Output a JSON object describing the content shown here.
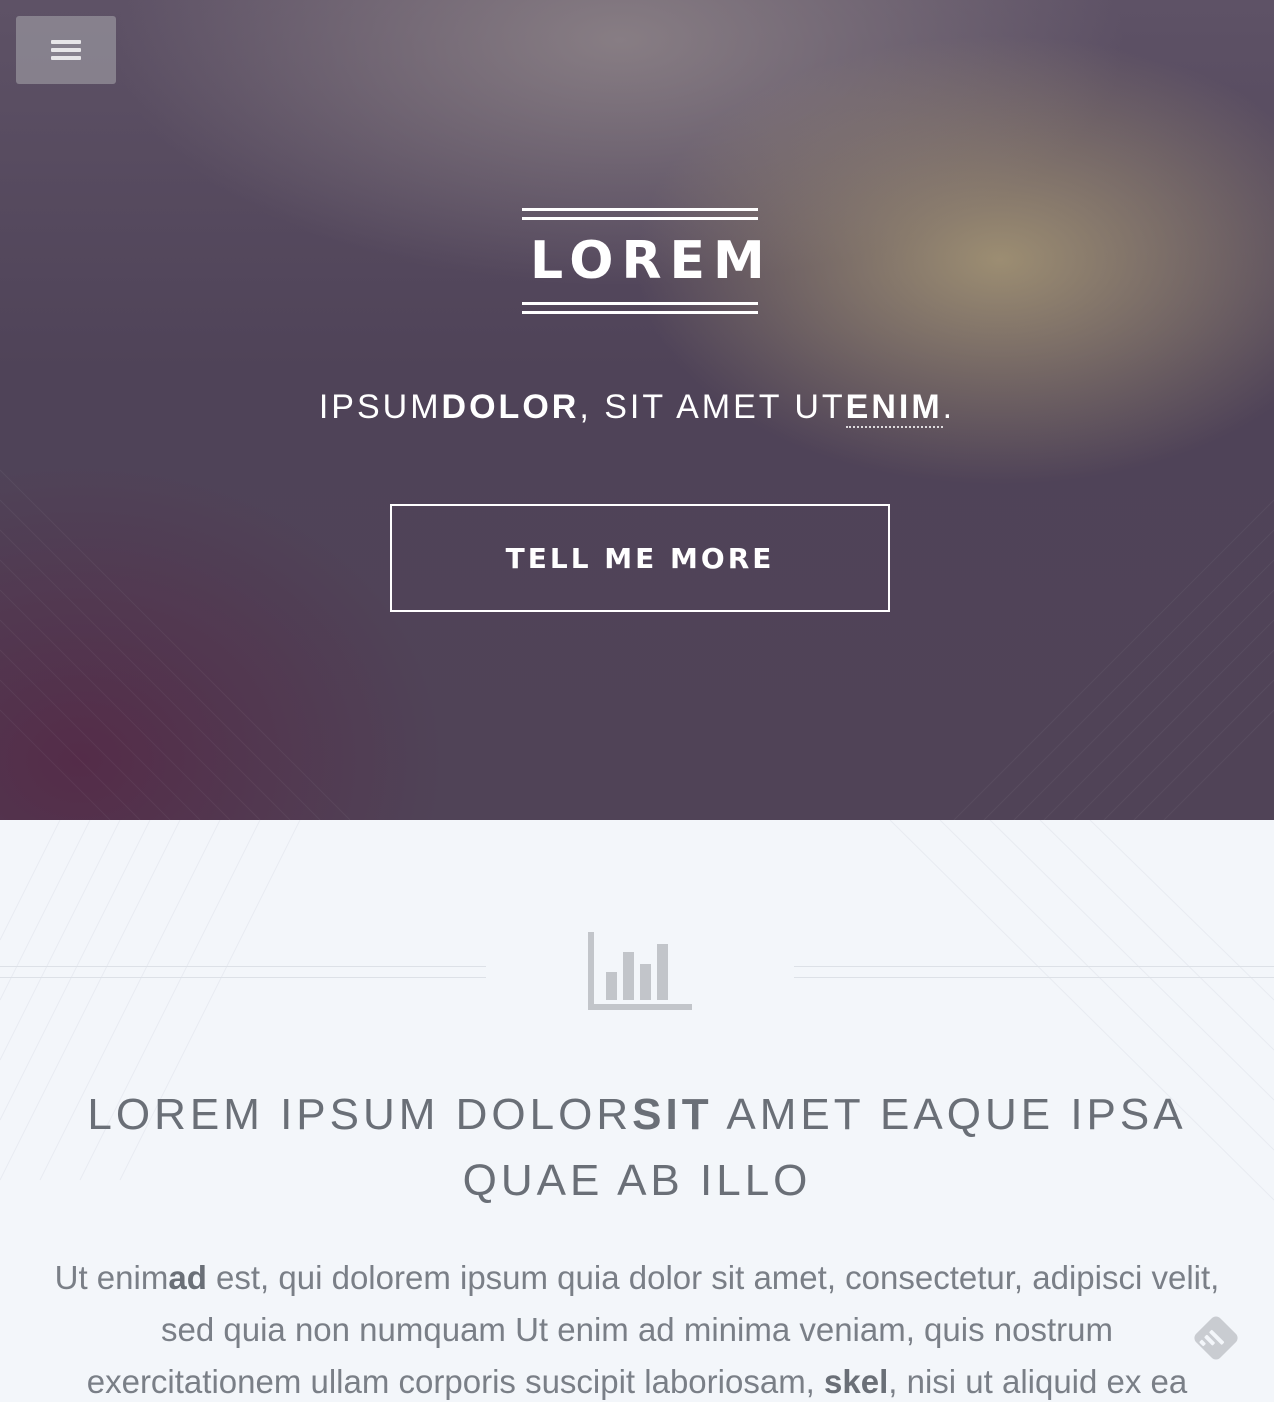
{
  "hero": {
    "menu_icon": "hamburger-menu-icon",
    "logo_text": "LOREM",
    "tagline": {
      "part1": "IPSUM",
      "part2_bold": "DOLOR",
      "part3": ", SIT AMET UT",
      "part4_bold": "ENIM",
      "part5": "."
    },
    "cta_label": "TELL ME MORE"
  },
  "banner": {
    "icon": "bar-chart-icon",
    "heading": {
      "part1": "LOREM IPSUM DOLOR",
      "part2_bold": "SIT",
      "part3": " AMET EAQUE IPSA QUAE AB ILLO"
    },
    "body": {
      "part1": "Ut enim",
      "part2_bold": "ad",
      "part3": " est, qui dolorem ipsum quia dolor sit amet, consectetur, adipisci velit, sed quia non numquam Ut enim ad minima veniam, quis nostrum exercitationem ullam corporis suscipit laboriosam, ",
      "part4_bold": "skel",
      "part5": ", nisi ut aliquid ex ea"
    }
  },
  "floating": {
    "icon": "feedly-icon"
  },
  "colors": {
    "banner_bg": "#f3f6fa",
    "heading_text": "#6a6f77",
    "hero_text": "#ffffff"
  }
}
